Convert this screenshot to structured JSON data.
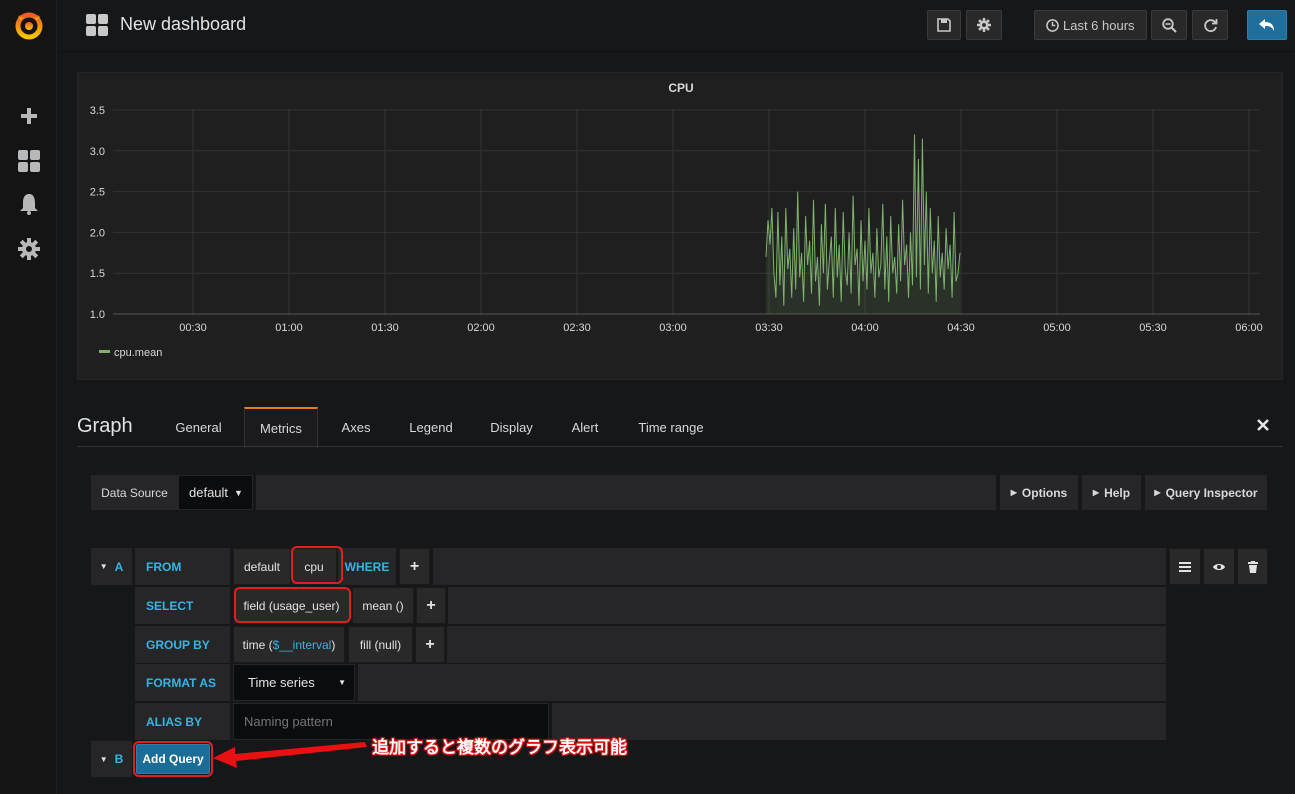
{
  "sidebar": {
    "items": [
      "logo-icon",
      "plus-icon",
      "dashboards-icon",
      "alert-bell-icon",
      "gear-icon"
    ]
  },
  "topbar": {
    "title": "New dashboard",
    "time_range": "Last 6 hours"
  },
  "panel": {
    "title": "CPU",
    "legend": "cpu.mean"
  },
  "chart_data": {
    "type": "line",
    "title": "CPU",
    "xlabel": "",
    "ylabel": "",
    "x_ticks": [
      "00:30",
      "01:00",
      "01:30",
      "02:00",
      "02:30",
      "03:00",
      "03:30",
      "04:00",
      "04:30",
      "05:00",
      "05:30",
      "06:00"
    ],
    "y_ticks": [
      "1.0",
      "1.5",
      "2.0",
      "2.5",
      "3.0",
      "3.5"
    ],
    "ylim": [
      1.0,
      3.5
    ],
    "series": [
      {
        "name": "cpu.mean",
        "color": "#7eb26d",
        "x_start": "03:30",
        "x_end": "04:30",
        "values": [
          1.7,
          2.15,
          1.85,
          2.3,
          1.5,
          1.2,
          2.25,
          1.35,
          1.95,
          1.1,
          2.3,
          1.55,
          1.8,
          1.2,
          2.05,
          1.3,
          2.5,
          1.45,
          1.75,
          1.15,
          2.2,
          1.6,
          1.9,
          1.25,
          2.4,
          1.4,
          1.7,
          1.1,
          2.1,
          1.5,
          2.35,
          1.3,
          1.65,
          1.95,
          1.2,
          2.3,
          1.45,
          1.85,
          1.15,
          2.25,
          1.55,
          1.35,
          2.0,
          1.25,
          2.45,
          1.6,
          1.8,
          1.1,
          2.15,
          1.4,
          1.9,
          1.3,
          2.3,
          1.5,
          1.75,
          1.2,
          2.05,
          1.45,
          1.6,
          2.35,
          1.3,
          1.95,
          1.15,
          2.2,
          1.5,
          1.7,
          1.25,
          2.1,
          1.4,
          2.4,
          1.6,
          1.85,
          1.2,
          2.0,
          1.35,
          3.2,
          1.45,
          2.9,
          1.3,
          3.15,
          1.6,
          2.5,
          1.25,
          2.3,
          1.5,
          1.9,
          1.15,
          2.2,
          1.45,
          1.75,
          1.3,
          2.05,
          1.55,
          1.85,
          1.2,
          2.25,
          1.4,
          1.5,
          1.75
        ]
      }
    ]
  },
  "editor": {
    "title": "Graph",
    "tabs": [
      "General",
      "Metrics",
      "Axes",
      "Legend",
      "Display",
      "Alert",
      "Time range"
    ],
    "active_tab": "Metrics",
    "datasource": {
      "label": "Data Source",
      "value": "default"
    },
    "buttons": {
      "options": "Options",
      "help": "Help",
      "inspector": "Query Inspector"
    },
    "query": {
      "ref": "A",
      "from_kw": "FROM",
      "policy": "default",
      "measurement": "cpu",
      "where_kw": "WHERE",
      "select_kw": "SELECT",
      "field": "field (usage_user)",
      "agg": "mean ()",
      "group_kw": "GROUP BY",
      "time_pre": "time (",
      "time_var": "$__interval",
      "time_post": ")",
      "fill": "fill (null)",
      "format_kw": "FORMAT AS",
      "format_val": "Time series",
      "alias_kw": "ALIAS BY",
      "alias_placeholder": "Naming pattern"
    },
    "query_b": {
      "ref": "B",
      "add": "Add Query"
    },
    "annotation": "追加すると複数のグラフ表示可能"
  }
}
